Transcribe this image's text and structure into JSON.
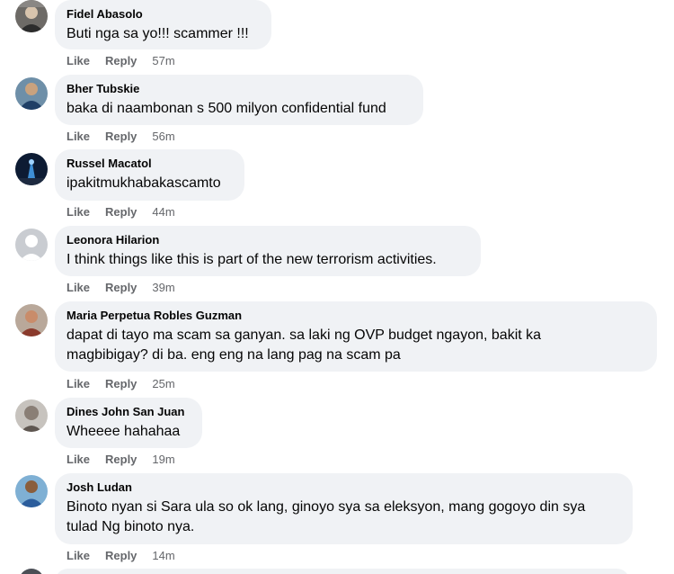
{
  "comments": [
    {
      "author": "Fidel Abasolo",
      "lines": [
        "Buti nga sa yo!!! scammer !!!"
      ],
      "like": "Like",
      "reply": "Reply",
      "time": "57m",
      "avatar": "user-photo-avatar"
    },
    {
      "author": "Bher Tubskie",
      "lines": [
        "baka di naambonan s 500 milyon confidential fund"
      ],
      "like": "Like",
      "reply": "Reply",
      "time": "56m",
      "avatar": "user-photo-avatar"
    },
    {
      "author": "Russel Macatol",
      "lines": [
        "ipakitmukhabakascamto"
      ],
      "like": "Like",
      "reply": "Reply",
      "time": "44m",
      "avatar": "night-lights-avatar"
    },
    {
      "author": "Leonora Hilarion",
      "lines": [
        "I think things like this is part of the new terrorism activities."
      ],
      "like": "Like",
      "reply": "Reply",
      "time": "39m",
      "avatar": "default-silhouette-avatar"
    },
    {
      "author": "Maria Perpetua Robles Guzman",
      "lines": [
        "dapat di tayo ma scam sa ganyan. sa laki ng OVP budget ngayon, bakit ka",
        "magbibigay? di ba. eng eng na lang pag na scam pa"
      ],
      "like": "Like",
      "reply": "Reply",
      "time": "25m",
      "avatar": "user-photo-avatar"
    },
    {
      "author": "Dines John San Juan",
      "lines": [
        "Wheeee hahahaa"
      ],
      "like": "Like",
      "reply": "Reply",
      "time": "19m",
      "avatar": "user-photo-avatar"
    },
    {
      "author": "Josh Ludan",
      "lines": [
        "Binoto nyan si Sara ula so ok lang, ginoyo sya sa eleksyon, mang gogoyo din sya",
        "tulad Ng binoto nya."
      ],
      "like": "Like",
      "reply": "Reply",
      "time": "14m",
      "avatar": "user-photo-avatar"
    }
  ],
  "colors": {
    "bubble": "#f0f2f5",
    "author_text": "#050505",
    "meta_text": "#65676b"
  }
}
